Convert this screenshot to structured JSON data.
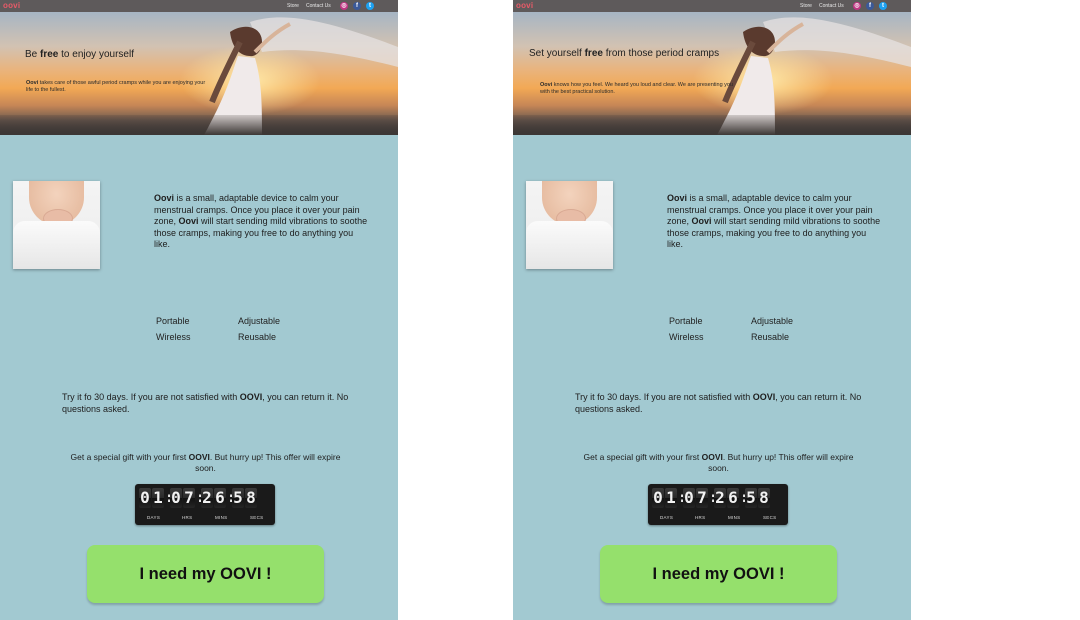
{
  "left": {
    "logo": "oovi",
    "nav": {
      "store": "Store",
      "contact": "Contact Us"
    },
    "hero": {
      "title_pre": "Be ",
      "title_bold": "free",
      "title_post": " to enjoy yourself",
      "sub_bold": "Oovi",
      "sub_text": " takes care of those awful period cramps while you are enjoying your life to the fullest."
    },
    "description": {
      "b1": "Oovi",
      "t1": " is a small, adaptable device to calm your menstrual cramps. Once you place it over your pain zone, ",
      "b2": "Oovi",
      "t2": " will start sending mild vibrations to soothe those cramps, making you free to do anything you like."
    },
    "features": [
      "Portable",
      "Adjustable",
      "Wireless",
      "Reusable"
    ],
    "trial": {
      "t1": "Try it fo 30 days. If you are not satisfied with ",
      "b": "OOVI",
      "t2": ", you can return it. No questions asked."
    },
    "gift": {
      "t1": "Get a special gift with your first ",
      "b": "OOVI",
      "t2": ". But hurry up! This offer will expire soon."
    },
    "timer": {
      "digits": [
        "0",
        "1",
        "0",
        "7",
        "2",
        "6",
        "5",
        "8"
      ],
      "labels": [
        "DAYS",
        "HRS",
        "MINS",
        "SECS"
      ]
    },
    "cta": "I need my OOVI !"
  },
  "right": {
    "logo": "oovi",
    "nav": {
      "store": "Store",
      "contact": "Contact Us"
    },
    "hero": {
      "title_pre": "Set yourself ",
      "title_bold": "free",
      "title_post": " from those period cramps",
      "sub_bold": "Oovi",
      "sub_text": " knows how you feel. We heard you loud and clear. We are presenting you with the best practical solution."
    },
    "description": {
      "b1": "Oovi",
      "t1": " is a small, adaptable device to calm your menstrual cramps. Once you place it over your pain zone, ",
      "b2": "Oovi",
      "t2": " will start sending mild vibrations to soothe those cramps, making you free to do anything you like."
    },
    "features": [
      "Portable",
      "Adjustable",
      "Wireless",
      "Reusable"
    ],
    "trial": {
      "t1": "Try it fo 30 days. If you are not satisfied with ",
      "b": "OOVI",
      "t2": ", you can return it. No questions asked."
    },
    "gift": {
      "t1": "Get a special gift with your first ",
      "b": "OOVI",
      "t2": ". But hurry up! This offer will expire soon."
    },
    "timer": {
      "digits": [
        "0",
        "1",
        "0",
        "7",
        "2",
        "6",
        "5",
        "8"
      ],
      "labels": [
        "DAYS",
        "HRS",
        "MINS",
        "SECS"
      ]
    },
    "cta": "I need my OOVI !"
  },
  "colors": {
    "panel_bg": "#a2c9d1",
    "topbar": "#5e5a5b",
    "logo": "#e85a68",
    "cta": "#95e06c",
    "timer": "#1a1a1a"
  },
  "icons": [
    "instagram-icon",
    "facebook-icon",
    "twitter-icon"
  ]
}
